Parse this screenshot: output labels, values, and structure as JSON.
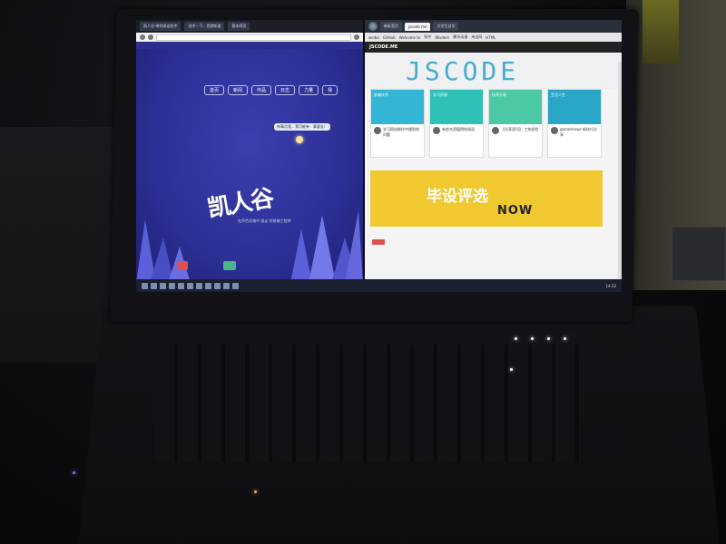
{
  "left_window": {
    "tabs": [
      "凯人谷-带你游走机中",
      "技术一下，您就知道",
      "基本网页"
    ],
    "nav": [
      "首页",
      "新闻",
      "作品",
      "日志",
      "力量",
      "我"
    ],
    "bubble": "有事点我，我可能有 · 事要去！",
    "logo": "凯人谷",
    "tagline": "在声色灵魂中 游走 的前端工程师"
  },
  "right_window": {
    "tabs": [
      "新标签页",
      "jscode.me",
      "大学生自学"
    ],
    "bookmarks": [
      "weibo",
      "GitHub",
      "Welcome to",
      "知乎",
      "Wisdom",
      "腾讯动漫",
      "淘宝网",
      "HTML"
    ],
    "site_name": "JSCODE.ME",
    "hero_text": "JSCODE",
    "cards": [
      {
        "top": "前端技术",
        "body": "学习网站制作中遇到的问题"
      },
      {
        "top": "学习资源",
        "body": "有些东西值得你阅读"
      },
      {
        "top": "技术分享",
        "body": "【分享资讯】 工作经验"
      },
      {
        "top": "生活人生",
        "body": "gameshows 新技巧分享"
      }
    ],
    "banner_title": "毕设评选",
    "banner_sub": "NOW"
  },
  "taskbar": {
    "time": "14:32"
  }
}
